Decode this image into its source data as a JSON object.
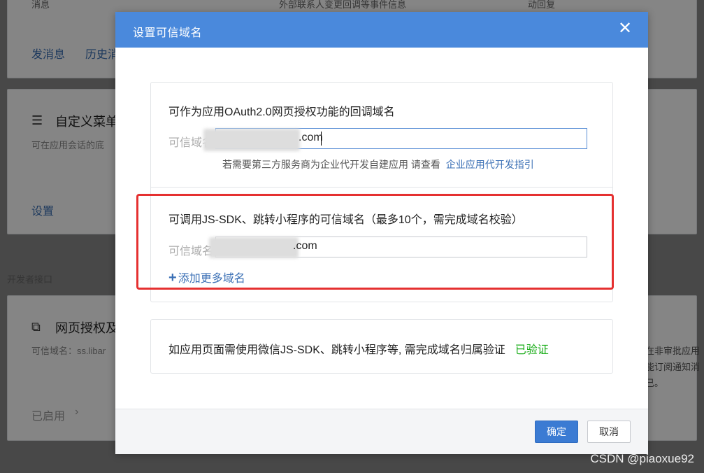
{
  "background": {
    "top_card": {
      "col1_label": "消息",
      "col2_label": "外部联系人变更回调等事件信息",
      "col3_label": "动回复"
    },
    "message_links": [
      "发消息",
      "历史消"
    ],
    "custom_menu": {
      "title": "自定义菜单",
      "desc": "可在应用会话的底",
      "link": "设置"
    },
    "dev_section_label": "开发者接口",
    "web_auth": {
      "title": "网页授权及",
      "desc": "可信域名：ss.libar",
      "status": "已启用"
    },
    "right_text": [
      "在非审批应用",
      "能订阅通知消",
      "己。"
    ]
  },
  "modal": {
    "title": "设置可信域名",
    "section1": {
      "title": "可作为应用OAuth2.0网页授权功能的回调域名",
      "field_label": "可信域名",
      "field_value": ".com",
      "hint_text": "若需要第三方服务商为企业代开发自建应用 请查看",
      "hint_link": "企业应用代开发指引"
    },
    "section2": {
      "title": "可调用JS-SDK、跳转小程序的可信域名（最多10个，需完成域名校验）",
      "field_label": "可信域名",
      "field_value": ".com",
      "add_more": "添加更多域名"
    },
    "section3": {
      "text": "如应用页面需使用微信JS-SDK、跳转小程序等, 需完成域名归属验证",
      "status": "已验证"
    },
    "confirm_button": "确定",
    "cancel_button": "取消"
  },
  "watermark": "CSDN @piaoxue92",
  "colors": {
    "header": "#4a89dc",
    "primary": "#3b7bd3",
    "link": "#3a6fb5",
    "verified": "#1aad19",
    "highlight": "#e53030"
  }
}
